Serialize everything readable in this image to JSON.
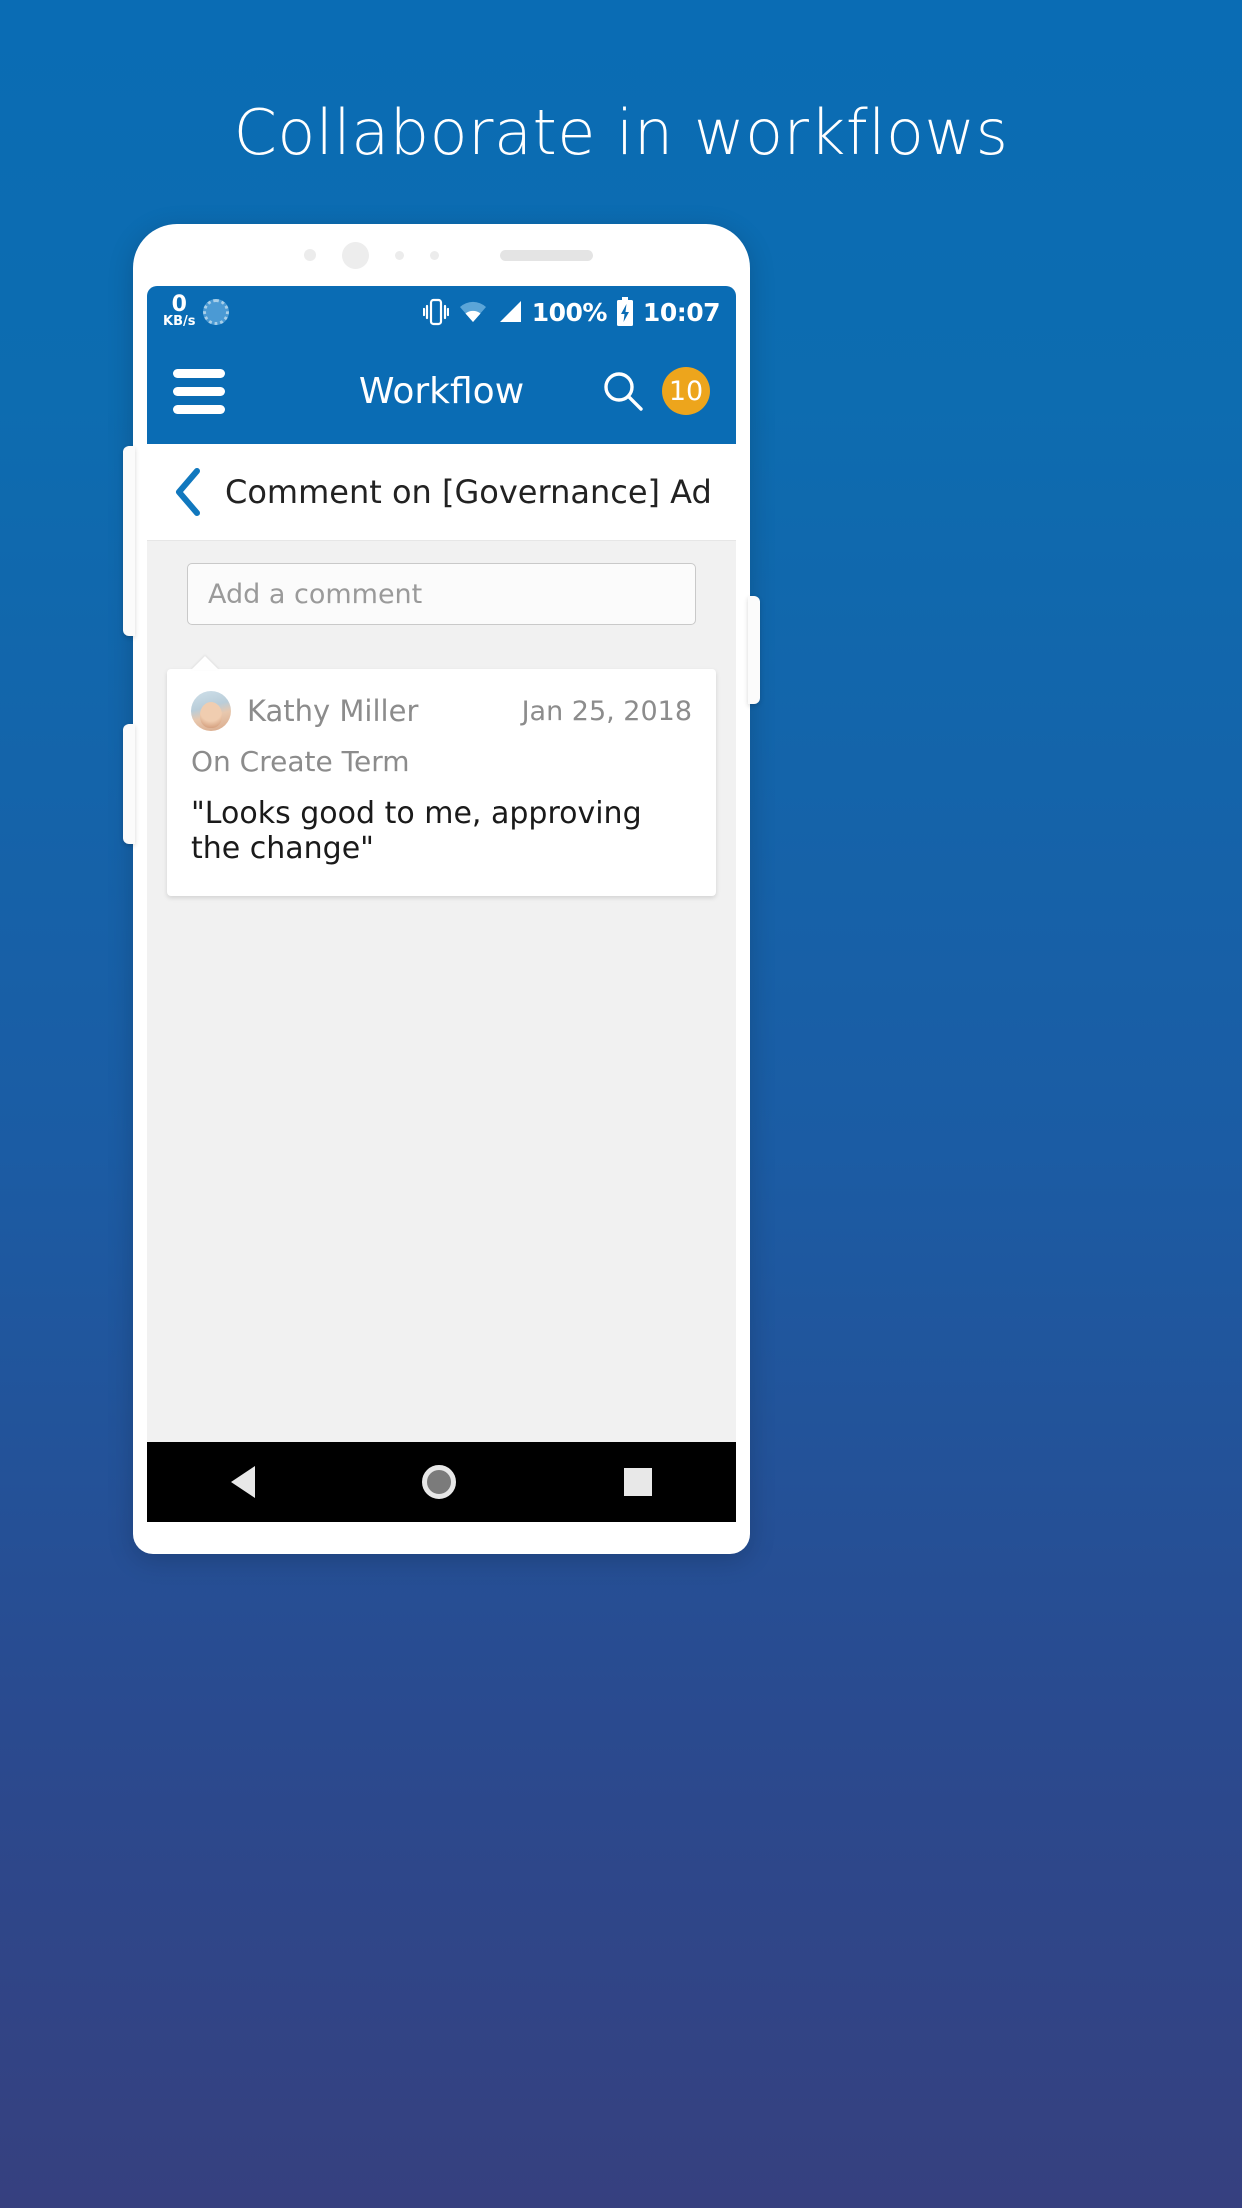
{
  "headline": "Collaborate in workflows",
  "theme": {
    "brand_blue": "#0a6cb4",
    "badge_orange": "#eda51c",
    "screen_bg": "#f1f1f1",
    "card_white": "#ffffff"
  },
  "status_bar": {
    "net_speed_value": "0",
    "net_speed_unit": "KB/s",
    "sync_icon": "sync-icon",
    "vibrate_icon": "vibrate-icon",
    "wifi_icon": "wifi-icon",
    "signal_icon": "signal-icon",
    "battery_percent": "100%",
    "battery_icon": "battery-charging-icon",
    "clock": "10:07"
  },
  "app_bar": {
    "menu_icon": "hamburger-menu-icon",
    "title": "Workflow",
    "search_icon": "search-icon",
    "badge_count": "10"
  },
  "sub_header": {
    "back_icon": "chevron-left-icon",
    "title": "Comment on [Governance] Add a ..."
  },
  "comment_input": {
    "value": "",
    "placeholder": "Add a comment"
  },
  "comments": [
    {
      "author": "Kathy Miller",
      "avatar": "avatar",
      "date": "Jan 25, 2018",
      "context": "On Create Term",
      "text": "\"Looks good to me, approving the change\""
    }
  ],
  "nav_bar": {
    "back": "nav-back-icon",
    "home": "nav-home-icon",
    "recents": "nav-recents-icon"
  }
}
